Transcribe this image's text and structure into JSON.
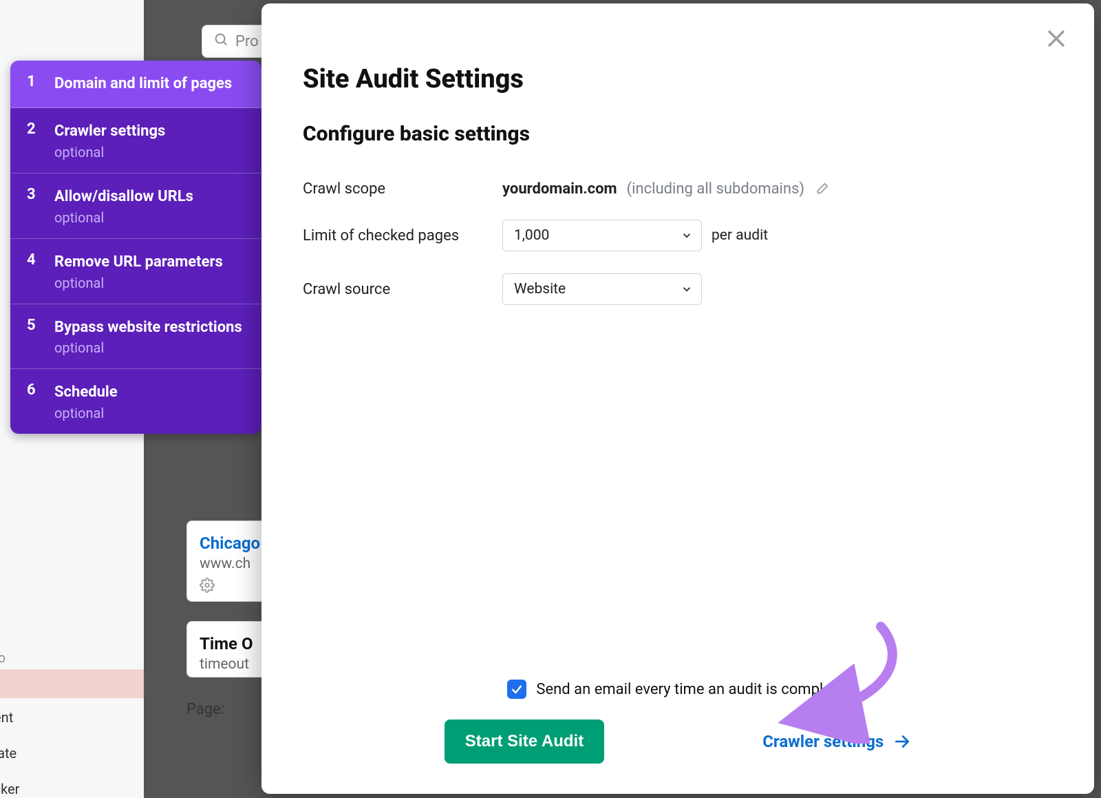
{
  "colors": {
    "wizard_bg": "#5c1fb9",
    "wizard_active": "#8a4cf0",
    "primary_btn": "#009e74",
    "link": "#0a6ed1",
    "checkbox": "#1f6feb"
  },
  "background": {
    "search_placeholder": "Pro",
    "cards": {
      "chicago_title": "Chicago",
      "chicago_sub": "www.ch",
      "timeout_title": "Time O",
      "timeout_sub": "timeout"
    },
    "page_label": "Page:",
    "left_stubs": {
      "seo": "SEO",
      "nent": "nent",
      "plate": "plate",
      "ecker": "ecker"
    }
  },
  "wizard": {
    "steps": [
      {
        "num": "1",
        "label": "Domain and limit of pages",
        "optional": "",
        "active": true
      },
      {
        "num": "2",
        "label": "Crawler settings",
        "optional": "optional",
        "active": false
      },
      {
        "num": "3",
        "label": "Allow/disallow URLs",
        "optional": "optional",
        "active": false
      },
      {
        "num": "4",
        "label": "Remove URL parameters",
        "optional": "optional",
        "active": false
      },
      {
        "num": "5",
        "label": "Bypass website restrictions",
        "optional": "optional",
        "active": false
      },
      {
        "num": "6",
        "label": "Schedule",
        "optional": "optional",
        "active": false
      }
    ]
  },
  "modal": {
    "title": "Site Audit Settings",
    "subtitle": "Configure basic settings",
    "rows": {
      "scope_label": "Crawl scope",
      "scope_domain": "yourdomain.com",
      "scope_hint": "(including all subdomains)",
      "limit_label": "Limit of checked pages",
      "limit_value": "1,000",
      "limit_suffix": "per audit",
      "source_label": "Crawl source",
      "source_value": "Website"
    },
    "footer": {
      "email_label": "Send an email every time an audit is complete.",
      "email_checked": true,
      "start_button": "Start Site Audit",
      "next_link": "Crawler settings"
    }
  }
}
